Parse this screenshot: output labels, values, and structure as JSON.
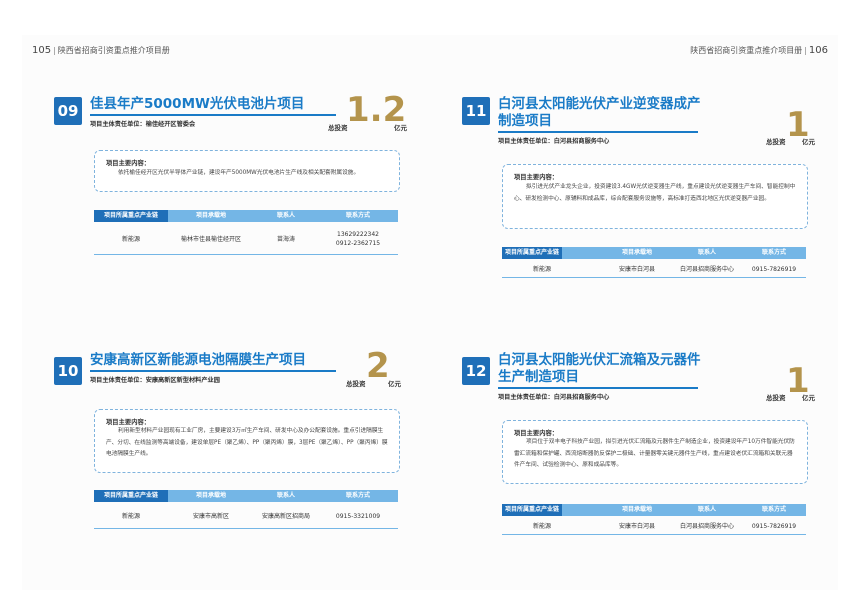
{
  "header": {
    "left": {
      "page": "105",
      "title": "陕西省招商引资重点推介项目册"
    },
    "right": {
      "page": "106",
      "title": "陕西省招商引资重点推介项目册"
    }
  },
  "table_headers": [
    "项目所属重点产业链",
    "项目承载地",
    "联系人",
    "联系方式"
  ],
  "projects": [
    {
      "number": "09",
      "title": [
        "佳县年产5000MW光伏电池片项目"
      ],
      "responsible_label": "项目主体责任单位：",
      "responsible": "榆佳经开区管委会",
      "invest_label": "总投资",
      "invest_amount": "1.2",
      "invest_unit": "亿元",
      "content_title": "项目主要内容：",
      "content": "依托榆佳经开区光伏半导体产业链，建设年产5000MW光伏电池片生产线及相关配套附属设施。",
      "row": {
        "chain": "新能源",
        "location": "榆林市佳县榆佳经开区",
        "contact": "苗海涛",
        "phone": [
          "13629222342",
          "0912-2362715"
        ]
      }
    },
    {
      "number": "11",
      "title": [
        "白河县太阳能光伏产业逆变器成产",
        "制造项目"
      ],
      "responsible_label": "项目主体责任单位：",
      "responsible": "白河县招商服务中心",
      "invest_label": "总投资",
      "invest_amount": "1",
      "invest_unit": "亿元",
      "content_title": "项目主要内容：",
      "content": "拟引进光伏产业龙头企业，投资建设3.4GW光伏逆变器生产线，重点建设光伏逆变器生产车间、智能控制中心、研发检测中心、原辅料和成品库，综合配套服务设施等，高标准打造西北地区光伏逆变器产业园。",
      "row": {
        "chain": "新能源",
        "location": "安康市白河县",
        "contact": "白河县招商服务中心",
        "phone": [
          "0915-7826919"
        ]
      }
    },
    {
      "number": "10",
      "title": [
        "安康高新区新能源电池隔膜生产项目"
      ],
      "responsible_label": "项目主体责任单位：",
      "responsible": "安康高新区新型材料产业园",
      "invest_label": "总投资",
      "invest_amount": "2",
      "invest_unit": "亿元",
      "content_title": "项目主要内容：",
      "content": "利用新型材料产业园现有工业厂房，主要建设3万㎡生产车间、研发中心及办公配套设施。重点引进隔膜生产、分切、在线监测等高端设备，建设单层PE（聚乙烯）、PP（聚丙烯）膜，3层PE（聚乙烯）、PP（聚丙烯）膜电池隔膜生产线。",
      "row": {
        "chain": "新能源",
        "location": "安康市高新区",
        "contact": "安康高新区招商局",
        "phone": [
          "0915-3321009"
        ]
      }
    },
    {
      "number": "12",
      "title": [
        "白河县太阳能光伏汇流箱及元器件",
        "生产制造项目"
      ],
      "responsible_label": "项目主体责任单位：",
      "responsible": "白河县招商服务中心",
      "invest_label": "总投资",
      "invest_amount": "1",
      "invest_unit": "亿元",
      "content_title": "项目主要内容：",
      "content": "项目位于双丰电子科技产业园，拟引进光伏汇流箱及元器件生产制造企业，投资建设年产10万件智能光伏防雷汇流箱和保护罐、西流熔断器防反保护二极础、计量器零关键元器件生产线，重点建设老伏汇流箱和关联元器件产车间、试验检测中心、原和成品库等。",
      "row": {
        "chain": "新能源",
        "location": "安康市白河县",
        "contact": "白河县招商服务中心",
        "phone": [
          "0915-7826919"
        ]
      }
    }
  ]
}
